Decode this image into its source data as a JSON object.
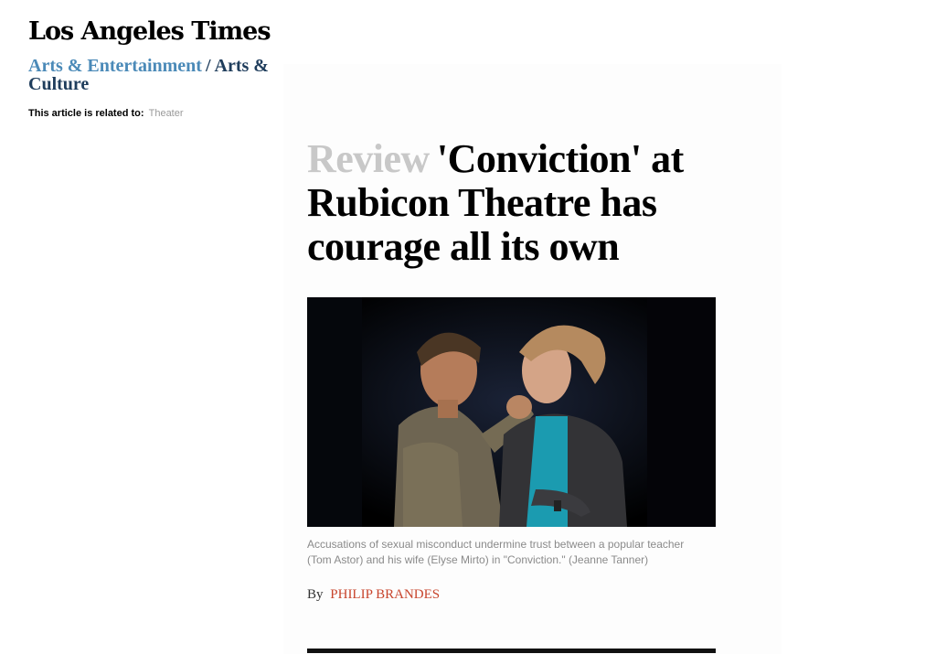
{
  "masthead": {
    "logo_text": "Los Angeles Times"
  },
  "section": {
    "main_label": "Arts & Entertainment",
    "separator": "/",
    "sub_label": "Arts & Culture"
  },
  "related": {
    "label": "This article is related to:",
    "topic": "Theater"
  },
  "article": {
    "kicker": "Review",
    "headline": "'Conviction' at Rubicon Theatre has courage all its own",
    "caption": "Accusations of sexual misconduct undermine trust between a popular teacher (Tom Astor) and his wife (Elyse Mirto) in \"Conviction.\" (Jeanne Tanner)",
    "byline_prefix": "By",
    "author": "PHILIP BRANDES"
  },
  "colors": {
    "section_main": "#4b8ab8",
    "section_sub": "#1f3d5c",
    "kicker": "#c8c8c8",
    "author": "#c8452d",
    "caption": "#8a8a8a"
  }
}
